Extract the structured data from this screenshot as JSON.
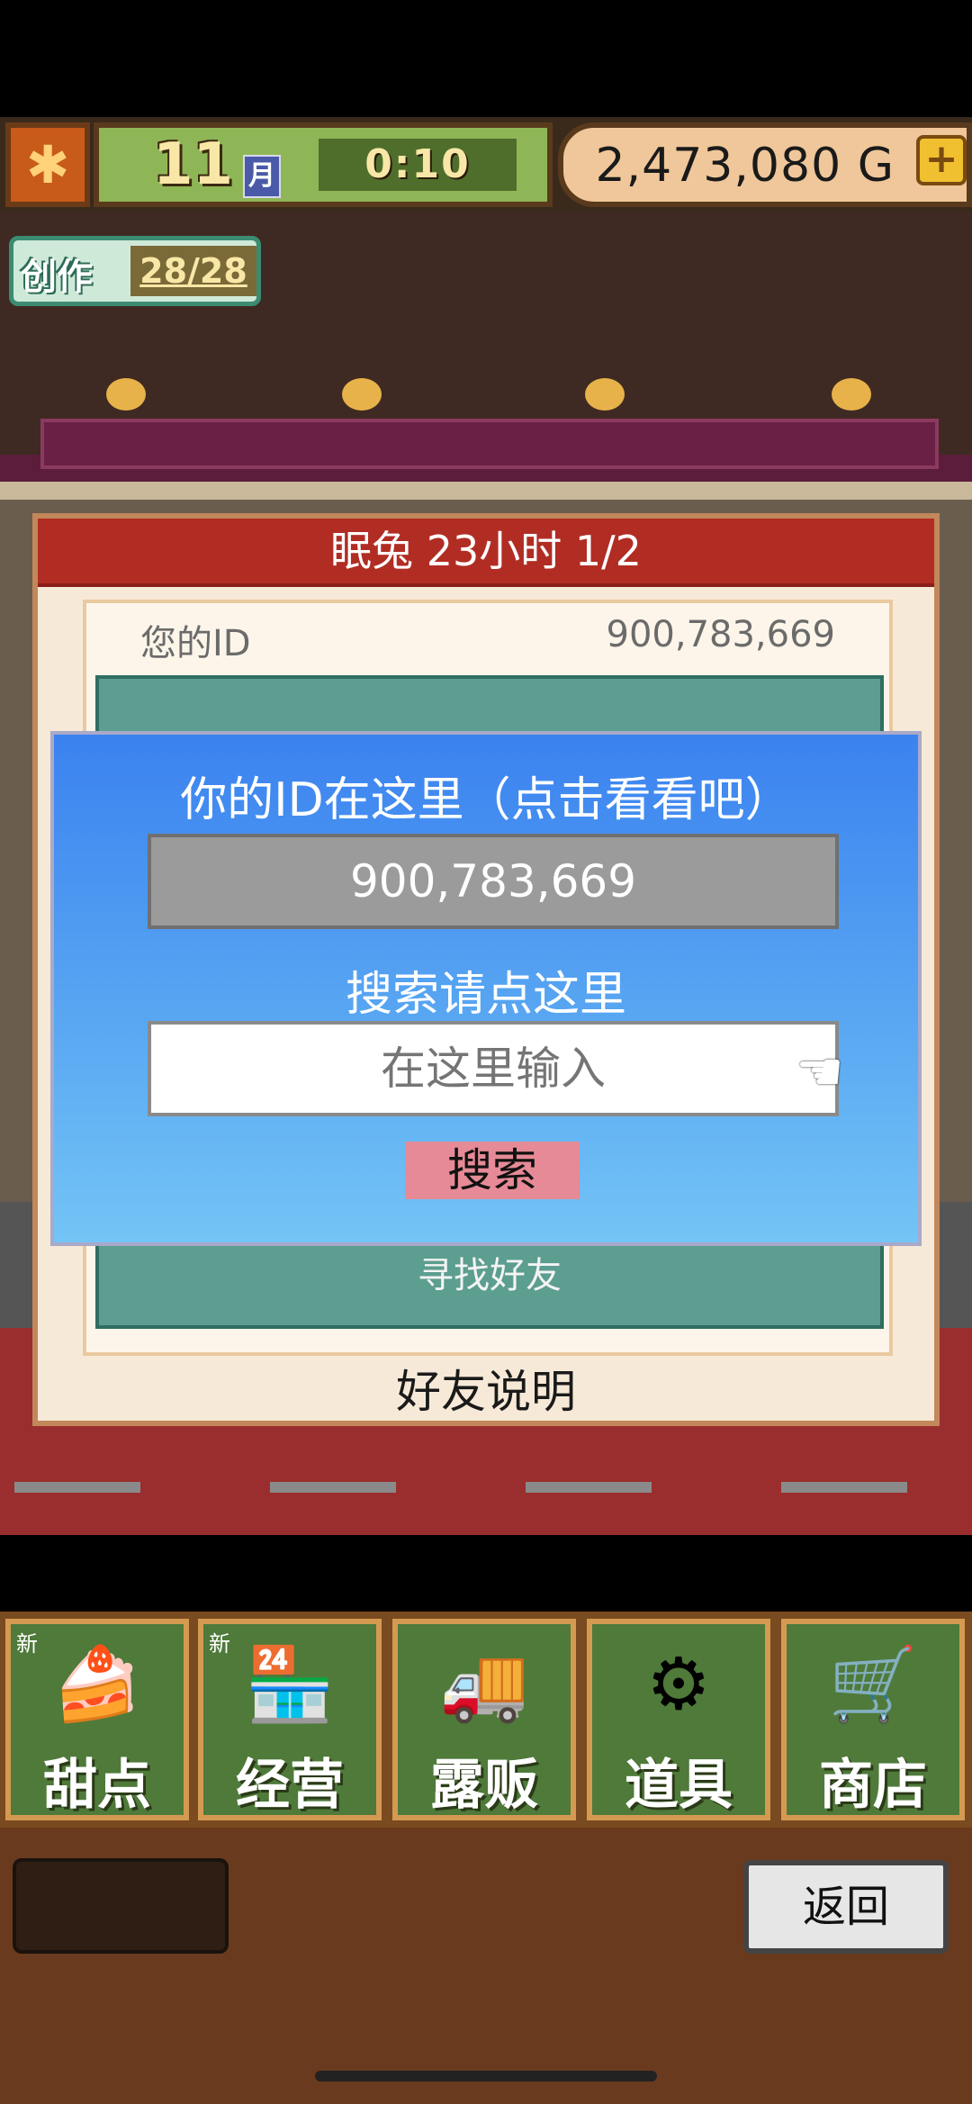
{
  "status_bar": {
    "month": "11",
    "month_unit": "月",
    "time": "0:10",
    "gold": "2,473,080 G",
    "season_icon": "maple-leaf-icon",
    "gold_plus_icon": "plus-icon"
  },
  "creation": {
    "label": "创作",
    "count": "28/28"
  },
  "friend_panel": {
    "header": "眠兔  23小时 1/2",
    "id_label": "您的ID",
    "id_value": "900,783,669",
    "find_friend": "寻找好友",
    "help": "好友说明"
  },
  "id_dialog": {
    "hint": "你的ID在这里（点击看看吧）",
    "id_value": "900,783,669",
    "search_hint": "搜索请点这里",
    "search_placeholder": "在这里输入",
    "search_button": "搜索",
    "pointer_icon": "pointing-hand-icon"
  },
  "tabs": [
    {
      "label": "甜点",
      "new": "新",
      "icon": "cake-icon"
    },
    {
      "label": "经营",
      "new": "新",
      "icon": "shop-icon"
    },
    {
      "label": "露贩",
      "new": "",
      "icon": "food-truck-icon"
    },
    {
      "label": "道具",
      "new": "",
      "icon": "gear-bag-icon"
    },
    {
      "label": "商店",
      "new": "",
      "icon": "cart-icon"
    }
  ],
  "bottom": {
    "back_label": "返回"
  },
  "colors": {
    "dialog_top": "#3b82f0",
    "dialog_bottom": "#74c4f6",
    "panel_header": "#b12d24",
    "search_button": "#e58a96",
    "tab_green": "#4f7a3a"
  }
}
